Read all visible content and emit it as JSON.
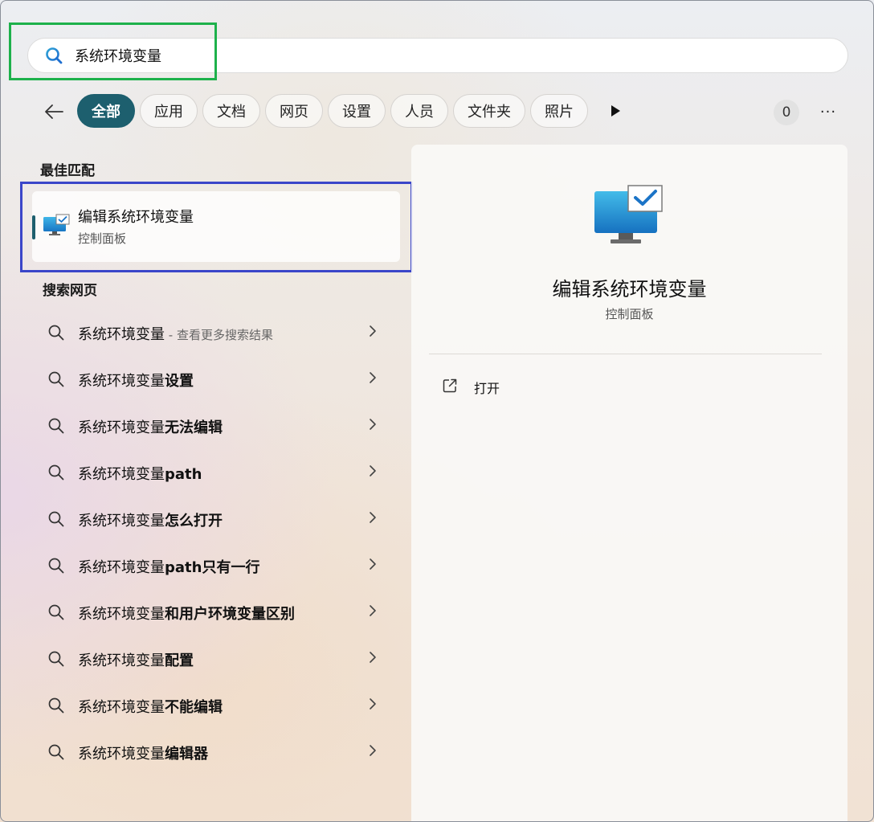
{
  "search": {
    "query": "系统环境变量"
  },
  "filters": {
    "chips": [
      "全部",
      "应用",
      "文档",
      "网页",
      "设置",
      "人员",
      "文件夹",
      "照片"
    ],
    "active_index": 0,
    "count": "0",
    "more": "···"
  },
  "best_match": {
    "section_title": "最佳匹配",
    "title": "编辑系统环境变量",
    "subtitle": "控制面板"
  },
  "web_search": {
    "section_title": "搜索网页",
    "items": [
      {
        "base": "系统环境变量",
        "bold": "",
        "hint": " - 查看更多搜索结果"
      },
      {
        "base": "系统环境变量",
        "bold": "设置",
        "hint": ""
      },
      {
        "base": "系统环境变量",
        "bold": "无法编辑",
        "hint": ""
      },
      {
        "base": "系统环境变量",
        "bold": "path",
        "hint": ""
      },
      {
        "base": "系统环境变量",
        "bold": "怎么打开",
        "hint": ""
      },
      {
        "base": "系统环境变量",
        "bold": "path只有一行",
        "hint": ""
      },
      {
        "base": "系统环境变量",
        "bold": "和用户环境变量区别",
        "hint": ""
      },
      {
        "base": "系统环境变量",
        "bold": "配置",
        "hint": ""
      },
      {
        "base": "系统环境变量",
        "bold": "不能编辑",
        "hint": ""
      },
      {
        "base": "系统环境变量",
        "bold": "编辑器",
        "hint": ""
      }
    ]
  },
  "detail": {
    "title": "编辑系统环境变量",
    "subtitle": "控制面板",
    "action_open": "打开"
  },
  "colors": {
    "accent": "#1d5f6e",
    "highlight_search": "#1db14b",
    "highlight_best_match": "#3a46c9"
  }
}
